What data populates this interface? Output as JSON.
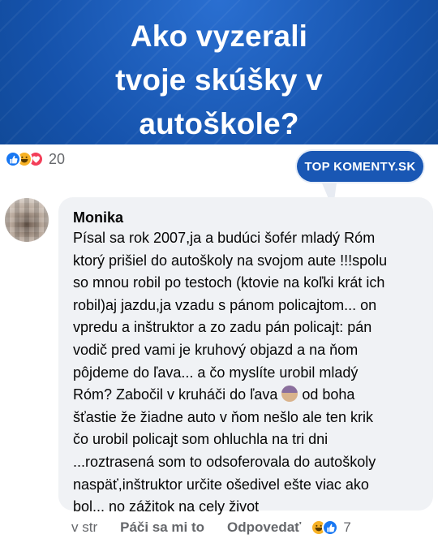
{
  "banner": {
    "title": "Ako vyzerali\ntvoje skúšky v\nautoškole?"
  },
  "post_reactions": {
    "icons": [
      "like-icon",
      "haha-icon",
      "love-icon"
    ],
    "count": "20"
  },
  "badge": {
    "label": "TOP KOMENTY.SK"
  },
  "comment": {
    "author": "Monika",
    "text_part1": "Písal sa rok 2007,ja a budúci šofér mladý Róm\nktorý prišiel do autoškoly na svojom aute !!!spolu\nso mnou robil po testoch (ktovie na koľki krát ich\nrobil)aj jazdu,ja vzadu s pánom policajtom... on\nvpredu a inštruktor a zo zadu pán policajt: pán\nvodič pred vami je kruhový objazd a na ňom\npôjdeme do ľava... a čo myslíte urobil mladý\nRóm? Zabočil v kruháči do ľava ",
    "text_part2": " od boha\nšťastie že žiadne auto v ňom nešlo ale ten krik\nčo urobil policajt som ohluchla na tri dni\n...roztrasená som to odsoferovala do autoškoly\nnaspäť,inštruktor určite ošedivel ešte viac ako\nbol... no zážitok na cely život",
    "inline_emoji": "woman-facepalming-icon"
  },
  "footer": {
    "time": "v str",
    "like_label": "Páči sa mi to",
    "reply_label": "Odpovedať",
    "reaction_count": "7"
  },
  "colors": {
    "banner_blue": "#1b5bb5",
    "fb_blue": "#1877f2",
    "bubble_bg": "#f0f2f5",
    "secondary_text": "#65676b"
  }
}
